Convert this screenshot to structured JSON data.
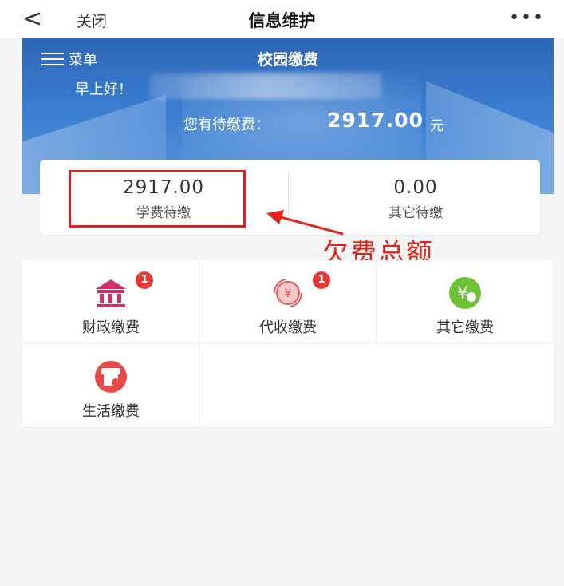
{
  "topbar": {
    "back_glyph": "<",
    "close_label": "关闭",
    "title": "信息维护",
    "more_glyph": "•••"
  },
  "hero": {
    "menu_label": "菜单",
    "title": "校园缴费",
    "greeting": "早上好！",
    "due_label": "您有待缴费：",
    "due_amount": "2917.00",
    "due_unit": "元"
  },
  "summary": [
    {
      "amount": "2917.00",
      "label": "学费待缴"
    },
    {
      "amount": "0.00",
      "label": "其它待缴"
    }
  ],
  "annotation": {
    "text": "欠费总额",
    "color": "#e0251d"
  },
  "tiles": [
    {
      "name": "财政缴费",
      "icon": "bank-icon",
      "badge": "1"
    },
    {
      "name": "代收缴费",
      "icon": "yuan-cycle-icon",
      "badge": "1"
    },
    {
      "name": "其它缴费",
      "icon": "yen-coin-icon",
      "badge": ""
    },
    {
      "name": "生活缴费",
      "icon": "shop-icon",
      "badge": ""
    }
  ],
  "colors": {
    "hero": "#3a7dd0",
    "badge": "#e53935",
    "accent_red": "#d9201f"
  }
}
